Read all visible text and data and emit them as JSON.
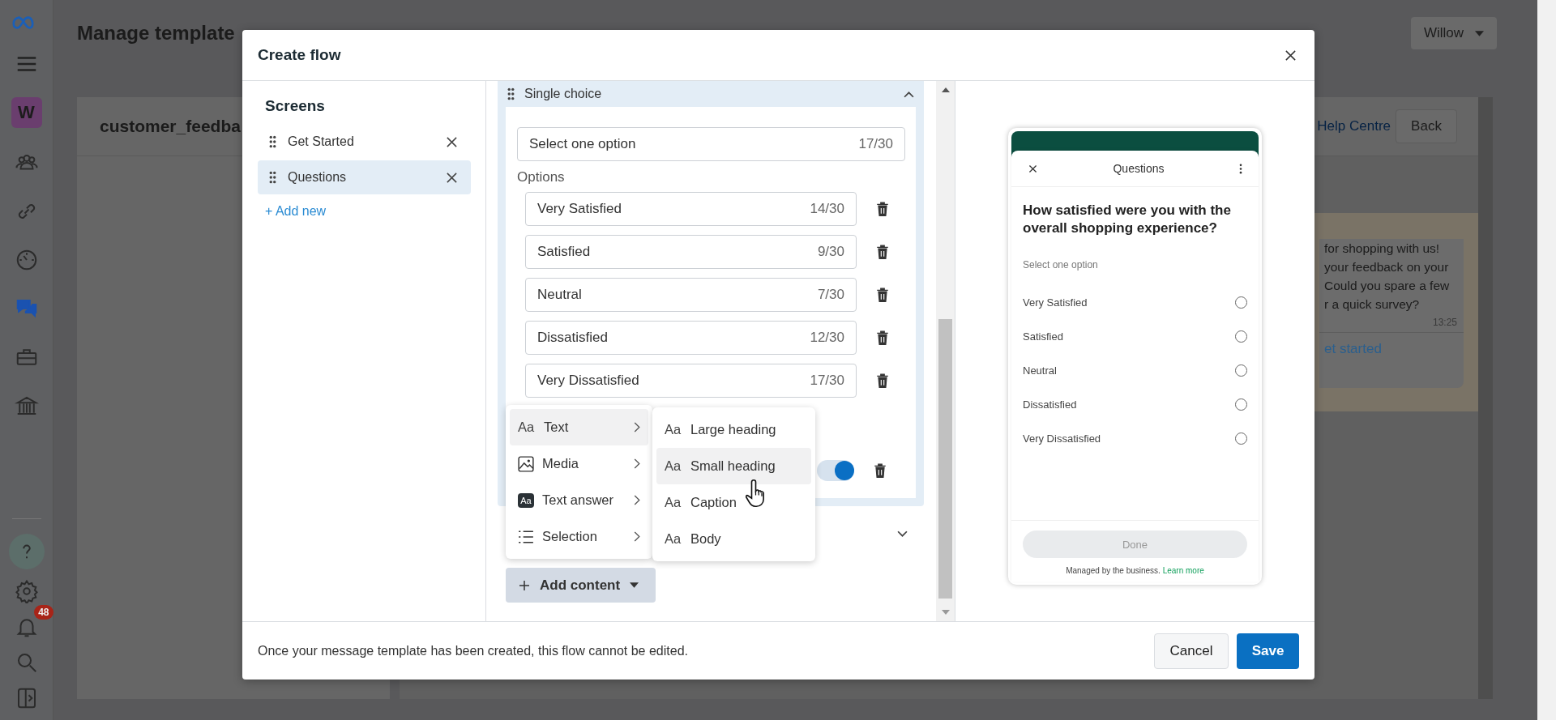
{
  "nav": {
    "account_initial": "W",
    "notification_count": "48",
    "items": [
      {
        "kind": "people",
        "selected": false
      },
      {
        "kind": "link",
        "selected": false
      },
      {
        "kind": "gauge",
        "selected": false
      },
      {
        "kind": "chat",
        "selected": true
      },
      {
        "kind": "briefcase",
        "selected": false
      },
      {
        "kind": "bank",
        "selected": false
      }
    ],
    "bottom_items": [
      {
        "kind": "help",
        "selected": false
      },
      {
        "kind": "settings",
        "selected": false
      },
      {
        "kind": "notifications",
        "selected": false
      },
      {
        "kind": "search",
        "selected": false
      },
      {
        "kind": "panel",
        "selected": false
      }
    ]
  },
  "page": {
    "title": "Manage template",
    "account": "Willow",
    "template_name": "customer_feedba",
    "help_link": "Help Centre",
    "back_button": "Back",
    "chat": {
      "lines": [
        "for shopping with us!",
        "your feedback on your",
        "Could you spare a few",
        "r a quick survey?"
      ],
      "time": "13:25",
      "button": "et started"
    }
  },
  "modal": {
    "title": "Create flow",
    "screens_heading": "Screens",
    "screens": [
      {
        "label": "Get Started",
        "selected": false
      },
      {
        "label": "Questions",
        "selected": true
      }
    ],
    "add_screen": "+ Add new",
    "sections": [
      {
        "title": "Single choice",
        "expanded": true
      },
      {
        "expanded": false
      }
    ],
    "label_field": {
      "value": "Select one option",
      "count": "17/30"
    },
    "options_heading": "Options",
    "options": [
      {
        "value": "Very Satisfied",
        "count": "14/30"
      },
      {
        "value": "Satisfied",
        "count": "9/30"
      },
      {
        "value": "Neutral",
        "count": "7/30"
      },
      {
        "value": "Dissatisfied",
        "count": "12/30"
      },
      {
        "value": "Very Dissatisfied",
        "count": "17/30"
      }
    ],
    "required_toggle": {
      "on": true
    },
    "add_content": "Add content",
    "menu": [
      {
        "kind": "text",
        "glyph": "Aa",
        "label": "Text",
        "selected": true
      },
      {
        "kind": "media",
        "label": "Media",
        "selected": false
      },
      {
        "kind": "text_answer",
        "glyph": "Aa",
        "label": "Text answer",
        "selected": false
      },
      {
        "kind": "selection",
        "label": "Selection",
        "selected": false
      }
    ],
    "submenu": [
      {
        "glyph": "Aa",
        "label": "Large heading",
        "selected": false
      },
      {
        "glyph": "Aa",
        "label": "Small heading",
        "selected": true
      },
      {
        "glyph": "Aa",
        "label": "Caption",
        "selected": false
      },
      {
        "glyph": "Aa",
        "label": "Body",
        "selected": false
      }
    ],
    "preview": {
      "screen_title": "Questions",
      "question": "How satisfied were you with the overall shopping experience?",
      "hint": "Select one option",
      "options": [
        {
          "label": "Very Satisfied",
          "selected": false
        },
        {
          "label": "Satisfied",
          "selected": false
        },
        {
          "label": "Neutral",
          "selected": false
        },
        {
          "label": "Dissatisfied",
          "selected": false
        },
        {
          "label": "Very Dissatisfied",
          "selected": false
        }
      ],
      "done": "Done",
      "footer": "Managed by the business.",
      "learn_more": "Learn more"
    },
    "note": "Once your message template has been created, this flow cannot be edited.",
    "cancel": "Cancel",
    "save": "Save"
  }
}
